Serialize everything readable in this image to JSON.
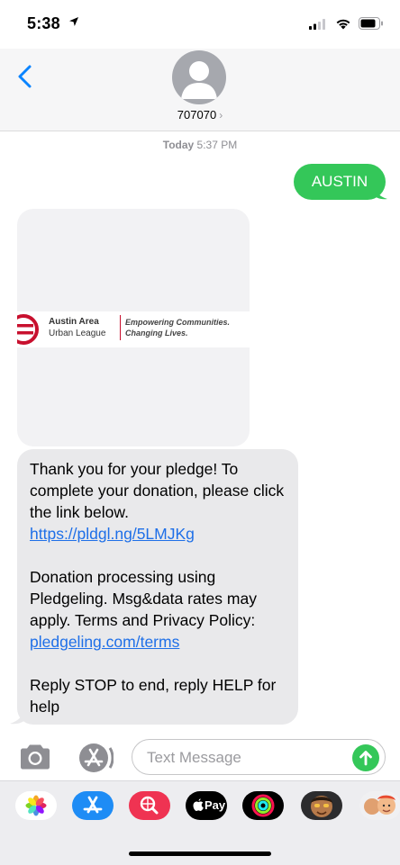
{
  "status_bar": {
    "time": "5:38"
  },
  "header": {
    "contact": "707070",
    "chevron": "›"
  },
  "thread": {
    "timestamp_day": "Today",
    "timestamp_time": "5:37 PM",
    "outgoing": "AUSTIN",
    "image": {
      "org_line1": "Austin Area",
      "org_line2": "Urban League",
      "tagline1": "Empowering Communities.",
      "tagline2": "Changing Lives."
    },
    "incoming": {
      "p1": "Thank you for your pledge! To complete your donation, please click the link below.",
      "link1": "https://pldgl.ng/5LMJKg",
      "p2": "Donation processing using Pledgeling. Msg&data rates may apply. Terms and Privacy Policy:",
      "link2": "pledgeling.com/terms",
      "p3": "Reply STOP to end, reply HELP for help"
    }
  },
  "compose": {
    "placeholder": "Text Message"
  },
  "app_tray": {
    "apple_pay_label": "Pay"
  },
  "colors": {
    "imessage_green": "#34c759",
    "link_blue": "#1e6fe8",
    "incoming_bubble": "#e9e9eb",
    "ios_blue": "#0a84ff"
  }
}
